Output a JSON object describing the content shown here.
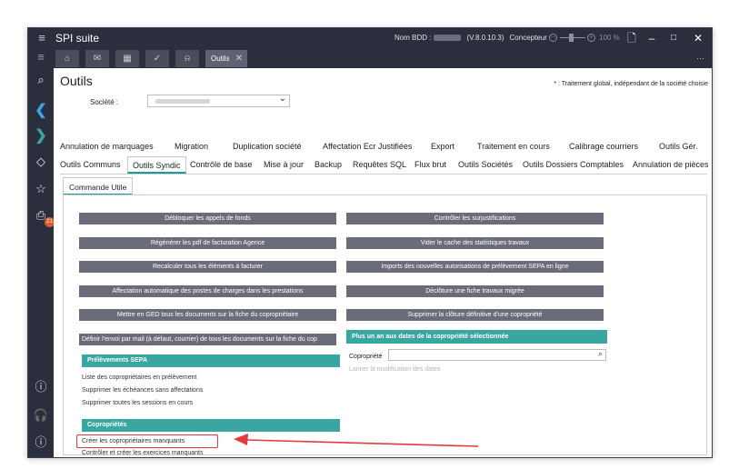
{
  "titlebar": {
    "app_title": "SPI suite",
    "db_label": "Nom BDD :",
    "version": "(V.8.0.10.3)",
    "role": "Concepteur",
    "zoom": "100 %",
    "zoom_level_percent": 100
  },
  "toolbar": {
    "active_tab": "Outils",
    "icons": [
      "home-icon",
      "mail-icon",
      "calendar-icon",
      "check-icon",
      "bell-icon"
    ]
  },
  "sidebar": {
    "badge_count": "21"
  },
  "page": {
    "title": "Outils",
    "note": "* : Traitement global, indépendant de la société choisie",
    "societe_label": "Société :"
  },
  "tabs_row1": [
    "Annulation de marquages",
    "Migration",
    "Duplication société",
    "Affectation Ecr Justifiées",
    "Export",
    "Traitement en cours",
    "Calibrage courriers",
    "Outils Gér."
  ],
  "tabs_row2": [
    "Outils Communs",
    "Outils Syndic",
    "Contrôle de base",
    "Mise à jour",
    "Backup",
    "Requêtes SQL",
    "Flux brut",
    "Outils Sociétés",
    "Outils Dossiers Comptables",
    "Annulation de pièces"
  ],
  "subtab": "Commande Utile",
  "buttons_left": [
    "Débloquer les appels de fonds",
    "Régénérer les pdf de facturation Agence",
    "Recalculer tous les éléments à facturer",
    "Affectation automatique des postes de charges dans les prestations",
    "Mettre en GED tous les documents sur la fiche du copropriétaire",
    "Définir l'envoi par mail (à défaut, courrier) de tous les documents sur la fiche du cop"
  ],
  "buttons_right": [
    "Contrôler les surjustifications",
    "Vider le cache des statistiques travaux",
    "Imports des nouvelles autorisations de prélèvement SEPA en ligne",
    "Déclôture une fiche travaux migrée",
    "Supprimer la clôture définitive d'une copropriété"
  ],
  "sepa": {
    "title": "Prélèvements SEPA",
    "links": [
      "Liste des copropriétaires en prélèvement",
      "Supprimer les échéances sans affectations",
      "Supprimer toutes les sessions en cours"
    ]
  },
  "coproprietes": {
    "title": "Copropriétés",
    "links": [
      "Créer les copropriétaires manquants",
      "Contrôler et créer les exercices manquants"
    ]
  },
  "dates_panel": {
    "title": "Plus un an aux dates de la copropriété sélectionnée",
    "copro_label": "Copropriété",
    "launch": "Lancer la modification des dates"
  },
  "colors": {
    "dark_bg": "#2b2e3d",
    "button_gray": "#6b6c7a",
    "teal": "#3aa6a1",
    "highlight_red": "#e23b3b"
  }
}
